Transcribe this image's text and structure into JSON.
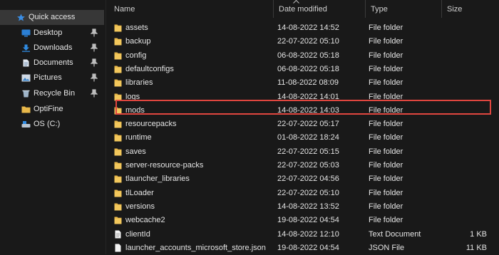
{
  "nav": {
    "quick_access": "Quick access",
    "items": [
      {
        "label": "Desktop",
        "icon": "desktop-icon",
        "pinned": true
      },
      {
        "label": "Downloads",
        "icon": "downloads-icon",
        "pinned": true
      },
      {
        "label": "Documents",
        "icon": "documents-icon",
        "pinned": true
      },
      {
        "label": "Pictures",
        "icon": "pictures-icon",
        "pinned": true
      },
      {
        "label": "Recycle Bin",
        "icon": "recycle-bin-icon",
        "pinned": true
      },
      {
        "label": "OptiFine",
        "icon": "folder-icon",
        "pinned": false
      },
      {
        "label": "OS (C:)",
        "icon": "drive-icon",
        "pinned": false
      }
    ]
  },
  "columns": {
    "name": "Name",
    "date": "Date modified",
    "type": "Type",
    "size": "Size"
  },
  "files": [
    {
      "name": "assets",
      "date": "14-08-2022 14:52",
      "type": "File folder",
      "size": "",
      "kind": "folder"
    },
    {
      "name": "backup",
      "date": "22-07-2022 05:10",
      "type": "File folder",
      "size": "",
      "kind": "folder"
    },
    {
      "name": "config",
      "date": "06-08-2022 05:18",
      "type": "File folder",
      "size": "",
      "kind": "folder"
    },
    {
      "name": "defaultconfigs",
      "date": "06-08-2022 05:18",
      "type": "File folder",
      "size": "",
      "kind": "folder"
    },
    {
      "name": "libraries",
      "date": "11-08-2022 08:09",
      "type": "File folder",
      "size": "",
      "kind": "folder"
    },
    {
      "name": "logs",
      "date": "14-08-2022 14:01",
      "type": "File folder",
      "size": "",
      "kind": "folder"
    },
    {
      "name": "mods",
      "date": "14-08-2022 14:03",
      "type": "File folder",
      "size": "",
      "kind": "folder",
      "highlighted": true
    },
    {
      "name": "resourcepacks",
      "date": "22-07-2022 05:17",
      "type": "File folder",
      "size": "",
      "kind": "folder"
    },
    {
      "name": "runtime",
      "date": "01-08-2022 18:24",
      "type": "File folder",
      "size": "",
      "kind": "folder"
    },
    {
      "name": "saves",
      "date": "22-07-2022 05:15",
      "type": "File folder",
      "size": "",
      "kind": "folder"
    },
    {
      "name": "server-resource-packs",
      "date": "22-07-2022 05:03",
      "type": "File folder",
      "size": "",
      "kind": "folder"
    },
    {
      "name": "tlauncher_libraries",
      "date": "22-07-2022 04:56",
      "type": "File folder",
      "size": "",
      "kind": "folder"
    },
    {
      "name": "tlLoader",
      "date": "22-07-2022 05:10",
      "type": "File folder",
      "size": "",
      "kind": "folder"
    },
    {
      "name": "versions",
      "date": "14-08-2022 13:52",
      "type": "File folder",
      "size": "",
      "kind": "folder"
    },
    {
      "name": "webcache2",
      "date": "19-08-2022 04:54",
      "type": "File folder",
      "size": "",
      "kind": "folder"
    },
    {
      "name": "clientId",
      "date": "14-08-2022 12:10",
      "type": "Text Document",
      "size": "1 KB",
      "kind": "text"
    },
    {
      "name": "launcher_accounts_microsoft_store.json",
      "date": "19-08-2022 04:54",
      "type": "JSON File",
      "size": "11 KB",
      "kind": "json"
    }
  ],
  "colors": {
    "background": "#191919",
    "selected_nav": "#373737",
    "highlight_border": "#e0463f",
    "folder": "#e8b84a"
  }
}
